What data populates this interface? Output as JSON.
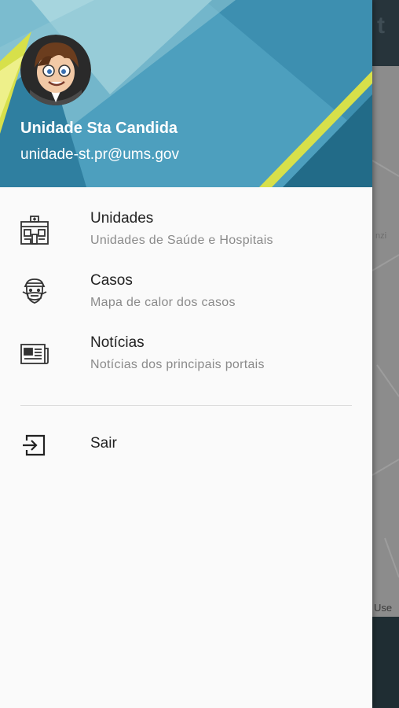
{
  "background_app": {
    "map_label_top": "nzi",
    "map_label_bottom": "Use"
  },
  "header": {
    "user_name": "Unidade Sta Candida",
    "user_email": "unidade-st.pr@ums.gov",
    "avatar_icon": "cartoon-avatar"
  },
  "menu": {
    "items": [
      {
        "title": "Unidades",
        "subtitle": "Unidades de Saúde e Hospitais",
        "icon": "building-icon"
      },
      {
        "title": "Casos",
        "subtitle": "Mapa de calor dos casos",
        "icon": "masked-face-icon"
      },
      {
        "title": "Notícias",
        "subtitle": "Notícias dos principais portais",
        "icon": "newspaper-icon"
      }
    ],
    "logout_label": "Sair",
    "logout_icon": "exit-icon"
  },
  "colors": {
    "header_blue": "#3d8fb0",
    "accent_yellow": "#d7e04a",
    "toolbar_dark": "#27343b"
  }
}
